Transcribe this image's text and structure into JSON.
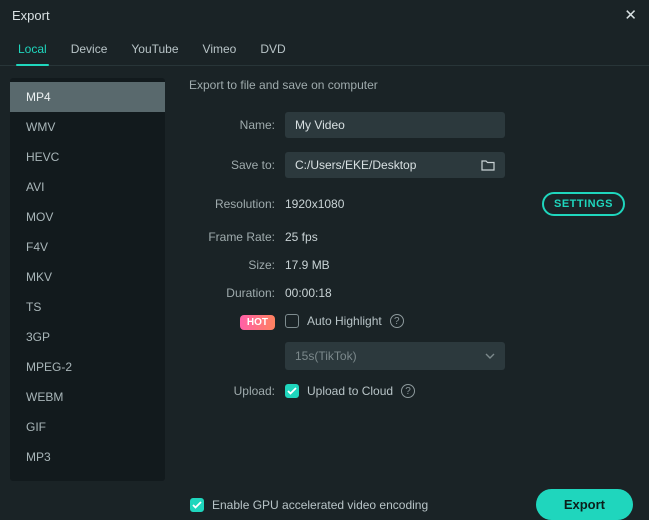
{
  "title": "Export",
  "tabs": [
    "Local",
    "Device",
    "YouTube",
    "Vimeo",
    "DVD"
  ],
  "active_tab": 0,
  "formats": [
    "MP4",
    "WMV",
    "HEVC",
    "AVI",
    "MOV",
    "F4V",
    "MKV",
    "TS",
    "3GP",
    "MPEG-2",
    "WEBM",
    "GIF",
    "MP3"
  ],
  "selected_format": 0,
  "heading": "Export to file and save on computer",
  "labels": {
    "name": "Name:",
    "save_to": "Save to:",
    "resolution": "Resolution:",
    "frame_rate": "Frame Rate:",
    "size": "Size:",
    "duration": "Duration:",
    "upload": "Upload:"
  },
  "values": {
    "name": "My Video",
    "save_to": "C:/Users/EKE/Desktop",
    "resolution": "1920x1080",
    "frame_rate": "25 fps",
    "size": "17.9 MB",
    "duration": "00:00:18"
  },
  "settings_btn": "SETTINGS",
  "hot_badge": "HOT",
  "auto_highlight": {
    "label": "Auto Highlight",
    "checked": false
  },
  "highlight_preset": "15s(TikTok)",
  "upload_cloud": {
    "label": "Upload to Cloud",
    "checked": true
  },
  "gpu": {
    "label": "Enable GPU accelerated video encoding",
    "checked": true
  },
  "export_btn": "Export"
}
